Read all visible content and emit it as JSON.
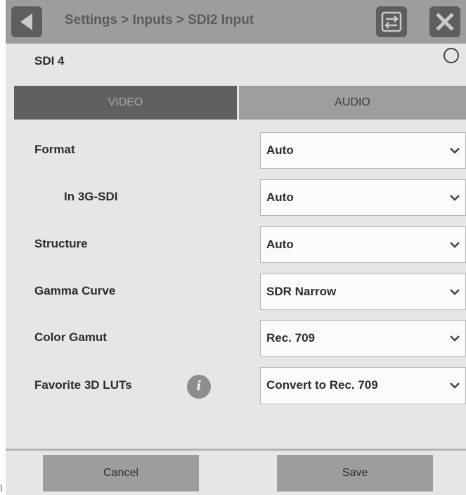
{
  "header": {
    "breadcrumb": "Settings > Inputs > SDI2 Input",
    "back_icon": "back-arrow-icon",
    "swap_icon": "swap-icon",
    "close_icon": "close-icon"
  },
  "input": {
    "name": "SDI 4"
  },
  "tabs": [
    {
      "label": "VIDEO",
      "active": true
    },
    {
      "label": "AUDIO",
      "active": false
    }
  ],
  "settings": [
    {
      "label": "Format",
      "value": "Auto"
    },
    {
      "label": "In 3G-SDI",
      "value": "Auto"
    },
    {
      "label": "Structure",
      "value": "Auto"
    },
    {
      "label": "Gamma Curve",
      "value": "SDR Narrow"
    },
    {
      "label": "Color Gamut",
      "value": "Rec. 709"
    },
    {
      "label": "Favorite 3D LUTs",
      "value": "Convert to Rec. 709"
    }
  ],
  "info_icon_glyph": "i",
  "footer": {
    "cancel_label": "Cancel",
    "save_label": "Save"
  },
  "edge_text": ")",
  "colors": {
    "header_bg": "#9d9d9d",
    "panel_bg": "#e6e6e6",
    "active_tab": "#606060",
    "inactive_tab": "#9e9e9e"
  }
}
